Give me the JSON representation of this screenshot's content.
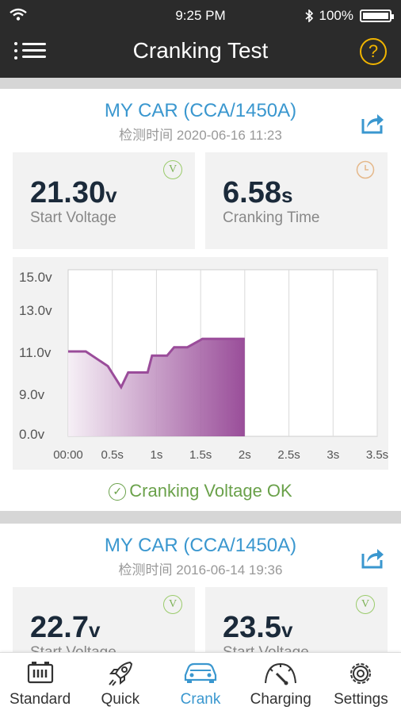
{
  "status": {
    "time": "9:25 PM",
    "battery": "100%"
  },
  "header": {
    "title": "Cranking Test",
    "menu_icon": "menu-icon",
    "help_icon": "help-icon"
  },
  "records": [
    {
      "car": "MY CAR (CCA/1450A)",
      "date": "检测时间 2020-06-16 11:23",
      "voltage": {
        "value": "21.30",
        "unit": "v",
        "label": "Start Voltage",
        "badge": "V"
      },
      "time": {
        "value": "6.58",
        "unit": "s",
        "label": "Cranking Time",
        "badge_icon": "clock-icon"
      },
      "result": "Cranking Voltage OK"
    },
    {
      "car": "MY CAR (CCA/1450A)",
      "date": "检测时间 2016-06-14 19:36",
      "voltage": {
        "value": "22.7",
        "unit": "v",
        "label": "Start Voltage",
        "badge": "V"
      },
      "voltage2": {
        "value": "23.5",
        "unit": "v",
        "label": "Start Voltage",
        "badge": "V"
      }
    }
  ],
  "chart_data": {
    "type": "area",
    "y_ticks": [
      "15.0v",
      "13.0v",
      "11.0v",
      "9.0v",
      "0.0v"
    ],
    "x_ticks": [
      "00:00",
      "0.5s",
      "1s",
      "1.5s",
      "2s",
      "2.5s",
      "3s",
      "3.5s"
    ],
    "x": [
      0,
      0.2,
      0.45,
      0.6,
      0.68,
      0.75,
      0.9,
      0.95,
      1.12,
      1.2,
      1.35,
      1.48,
      1.52,
      1.65,
      2.0
    ],
    "y": [
      11.0,
      11.0,
      10.3,
      9.3,
      10.0,
      10.0,
      10.0,
      10.8,
      10.8,
      11.2,
      11.2,
      11.5,
      11.6,
      11.6,
      11.6
    ],
    "colors": {
      "fill_dark": "#8e3a8e",
      "fill_light": "#f5eef5",
      "line": "#9a4c9a"
    }
  },
  "tabs": [
    {
      "label": "Standard",
      "icon": "battery-icon"
    },
    {
      "label": "Quick",
      "icon": "rocket-icon"
    },
    {
      "label": "Crank",
      "icon": "car-icon",
      "active": true
    },
    {
      "label": "Charging",
      "icon": "gauge-icon"
    },
    {
      "label": "Settings",
      "icon": "gear-icon"
    }
  ]
}
